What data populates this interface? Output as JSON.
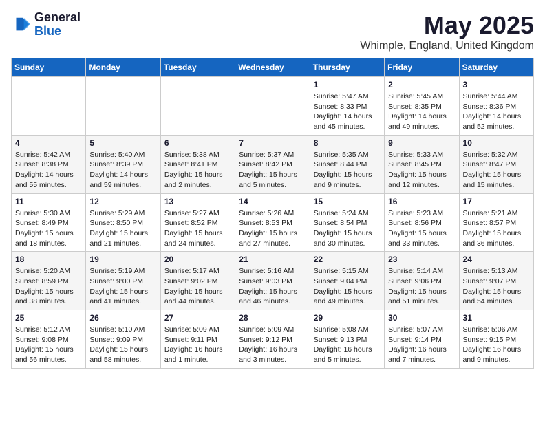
{
  "header": {
    "logo_general": "General",
    "logo_blue": "Blue",
    "title": "May 2025",
    "location": "Whimple, England, United Kingdom"
  },
  "weekdays": [
    "Sunday",
    "Monday",
    "Tuesday",
    "Wednesday",
    "Thursday",
    "Friday",
    "Saturday"
  ],
  "rows": [
    [
      {
        "day": "",
        "details": ""
      },
      {
        "day": "",
        "details": ""
      },
      {
        "day": "",
        "details": ""
      },
      {
        "day": "",
        "details": ""
      },
      {
        "day": "1",
        "details": "Sunrise: 5:47 AM\nSunset: 8:33 PM\nDaylight: 14 hours\nand 45 minutes."
      },
      {
        "day": "2",
        "details": "Sunrise: 5:45 AM\nSunset: 8:35 PM\nDaylight: 14 hours\nand 49 minutes."
      },
      {
        "day": "3",
        "details": "Sunrise: 5:44 AM\nSunset: 8:36 PM\nDaylight: 14 hours\nand 52 minutes."
      }
    ],
    [
      {
        "day": "4",
        "details": "Sunrise: 5:42 AM\nSunset: 8:38 PM\nDaylight: 14 hours\nand 55 minutes."
      },
      {
        "day": "5",
        "details": "Sunrise: 5:40 AM\nSunset: 8:39 PM\nDaylight: 14 hours\nand 59 minutes."
      },
      {
        "day": "6",
        "details": "Sunrise: 5:38 AM\nSunset: 8:41 PM\nDaylight: 15 hours\nand 2 minutes."
      },
      {
        "day": "7",
        "details": "Sunrise: 5:37 AM\nSunset: 8:42 PM\nDaylight: 15 hours\nand 5 minutes."
      },
      {
        "day": "8",
        "details": "Sunrise: 5:35 AM\nSunset: 8:44 PM\nDaylight: 15 hours\nand 9 minutes."
      },
      {
        "day": "9",
        "details": "Sunrise: 5:33 AM\nSunset: 8:45 PM\nDaylight: 15 hours\nand 12 minutes."
      },
      {
        "day": "10",
        "details": "Sunrise: 5:32 AM\nSunset: 8:47 PM\nDaylight: 15 hours\nand 15 minutes."
      }
    ],
    [
      {
        "day": "11",
        "details": "Sunrise: 5:30 AM\nSunset: 8:49 PM\nDaylight: 15 hours\nand 18 minutes."
      },
      {
        "day": "12",
        "details": "Sunrise: 5:29 AM\nSunset: 8:50 PM\nDaylight: 15 hours\nand 21 minutes."
      },
      {
        "day": "13",
        "details": "Sunrise: 5:27 AM\nSunset: 8:52 PM\nDaylight: 15 hours\nand 24 minutes."
      },
      {
        "day": "14",
        "details": "Sunrise: 5:26 AM\nSunset: 8:53 PM\nDaylight: 15 hours\nand 27 minutes."
      },
      {
        "day": "15",
        "details": "Sunrise: 5:24 AM\nSunset: 8:54 PM\nDaylight: 15 hours\nand 30 minutes."
      },
      {
        "day": "16",
        "details": "Sunrise: 5:23 AM\nSunset: 8:56 PM\nDaylight: 15 hours\nand 33 minutes."
      },
      {
        "day": "17",
        "details": "Sunrise: 5:21 AM\nSunset: 8:57 PM\nDaylight: 15 hours\nand 36 minutes."
      }
    ],
    [
      {
        "day": "18",
        "details": "Sunrise: 5:20 AM\nSunset: 8:59 PM\nDaylight: 15 hours\nand 38 minutes."
      },
      {
        "day": "19",
        "details": "Sunrise: 5:19 AM\nSunset: 9:00 PM\nDaylight: 15 hours\nand 41 minutes."
      },
      {
        "day": "20",
        "details": "Sunrise: 5:17 AM\nSunset: 9:02 PM\nDaylight: 15 hours\nand 44 minutes."
      },
      {
        "day": "21",
        "details": "Sunrise: 5:16 AM\nSunset: 9:03 PM\nDaylight: 15 hours\nand 46 minutes."
      },
      {
        "day": "22",
        "details": "Sunrise: 5:15 AM\nSunset: 9:04 PM\nDaylight: 15 hours\nand 49 minutes."
      },
      {
        "day": "23",
        "details": "Sunrise: 5:14 AM\nSunset: 9:06 PM\nDaylight: 15 hours\nand 51 minutes."
      },
      {
        "day": "24",
        "details": "Sunrise: 5:13 AM\nSunset: 9:07 PM\nDaylight: 15 hours\nand 54 minutes."
      }
    ],
    [
      {
        "day": "25",
        "details": "Sunrise: 5:12 AM\nSunset: 9:08 PM\nDaylight: 15 hours\nand 56 minutes."
      },
      {
        "day": "26",
        "details": "Sunrise: 5:10 AM\nSunset: 9:09 PM\nDaylight: 15 hours\nand 58 minutes."
      },
      {
        "day": "27",
        "details": "Sunrise: 5:09 AM\nSunset: 9:11 PM\nDaylight: 16 hours\nand 1 minute."
      },
      {
        "day": "28",
        "details": "Sunrise: 5:09 AM\nSunset: 9:12 PM\nDaylight: 16 hours\nand 3 minutes."
      },
      {
        "day": "29",
        "details": "Sunrise: 5:08 AM\nSunset: 9:13 PM\nDaylight: 16 hours\nand 5 minutes."
      },
      {
        "day": "30",
        "details": "Sunrise: 5:07 AM\nSunset: 9:14 PM\nDaylight: 16 hours\nand 7 minutes."
      },
      {
        "day": "31",
        "details": "Sunrise: 5:06 AM\nSunset: 9:15 PM\nDaylight: 16 hours\nand 9 minutes."
      }
    ]
  ]
}
